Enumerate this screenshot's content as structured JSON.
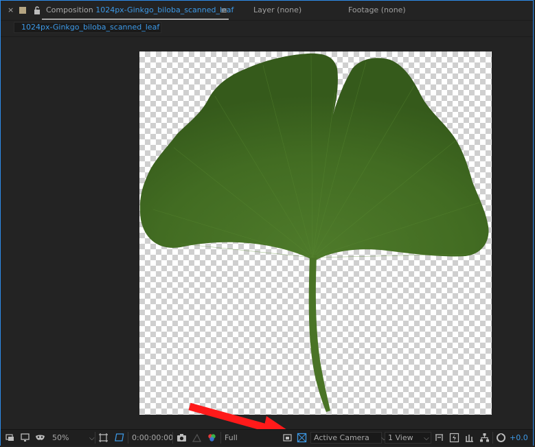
{
  "header": {
    "close": "×",
    "composition_label": "Composition",
    "composition_name": "1024px-Ginkgo_biloba_scanned_leaf",
    "menu": "≡",
    "layer_tab": "Layer (none)",
    "footage_tab": "Footage (none)"
  },
  "subtab": {
    "label": "1024px-Ginkgo_biloba_scanned_leaf"
  },
  "toolbar": {
    "magnification": "50%",
    "timecode": "0:00:00:00",
    "resolution": "Full",
    "camera": "Active Camera",
    "views": "1 View",
    "exposure": "+0.0",
    "chevron": "⌵"
  },
  "colors": {
    "accent": "#3d9ae8",
    "leaf": "#3f6620",
    "arrow": "#ff1a1a"
  },
  "icons": {
    "close": "close-icon",
    "label_color": "color-label-swatch",
    "lock": "lock-icon",
    "menu": "panel-menu-icon",
    "snapshot": "camera-icon",
    "channels": "rgb-channels-icon",
    "transparency_grid": "transparency-grid-icon",
    "region": "region-of-interest-icon"
  }
}
